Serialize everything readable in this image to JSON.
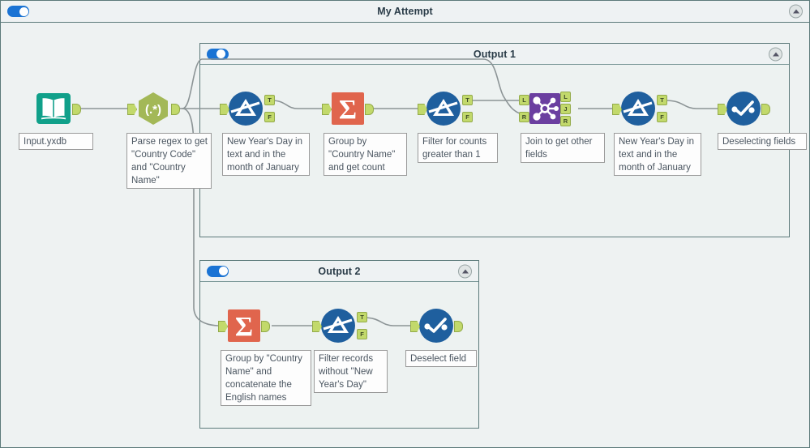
{
  "window": {
    "title": "My Attempt",
    "toggle_state": "on",
    "collapse_icon": "chevron-up-icon"
  },
  "containers": [
    {
      "id": "output1",
      "title": "Output 1",
      "toggle_state": "on",
      "collapse_icon": "chevron-up-icon"
    },
    {
      "id": "output2",
      "title": "Output 2",
      "toggle_state": "on",
      "collapse_icon": "chevron-up-icon"
    }
  ],
  "tools": [
    {
      "id": "input-data",
      "type": "input-data-tool",
      "icon": "open-book-icon",
      "color": "#10a08a",
      "annotation": "Input.yxdb",
      "outputs": [
        ""
      ]
    },
    {
      "id": "regex",
      "type": "regex-tool",
      "icon": "regex-hexagon-icon",
      "color": "#a3b857",
      "label": "(.*)",
      "annotation": "Parse regex to get \"Country Code\" and \"Country Name\"",
      "inputs": [
        ""
      ],
      "outputs": [
        ""
      ]
    },
    {
      "id": "filter-1",
      "type": "filter-tool",
      "icon": "filter-funnel-icon",
      "color": "#1f5f9e",
      "annotation": "New Year's Day in text and in the month of January",
      "inputs": [
        ""
      ],
      "outputs": [
        "T",
        "F"
      ]
    },
    {
      "id": "summarize-1",
      "type": "summarize-tool",
      "icon": "sigma-icon",
      "color": "#e0654d",
      "annotation": "Group by \"Country Name\" and get count",
      "inputs": [
        ""
      ],
      "outputs": [
        ""
      ]
    },
    {
      "id": "filter-2",
      "type": "filter-tool",
      "icon": "filter-funnel-icon",
      "color": "#1f5f9e",
      "annotation": "Filter for counts greater than 1",
      "inputs": [
        ""
      ],
      "outputs": [
        "T",
        "F"
      ]
    },
    {
      "id": "join",
      "type": "join-tool",
      "icon": "join-network-icon",
      "color": "#6b3fa0",
      "annotation": "Join to get other fields",
      "inputs": [
        "L",
        "R"
      ],
      "outputs": [
        "L",
        "J",
        "R"
      ]
    },
    {
      "id": "filter-3",
      "type": "filter-tool",
      "icon": "filter-funnel-icon",
      "color": "#1f5f9e",
      "annotation": "New Year's Day in text and in the month of January",
      "inputs": [
        ""
      ],
      "outputs": [
        "T",
        "F"
      ]
    },
    {
      "id": "select-1",
      "type": "select-tool",
      "icon": "select-check-icon",
      "color": "#1f5f9e",
      "annotation": "Deselecting fields",
      "inputs": [
        ""
      ],
      "outputs": [
        ""
      ]
    },
    {
      "id": "summarize-2",
      "type": "summarize-tool",
      "icon": "sigma-icon",
      "color": "#e0654d",
      "annotation": "Group by \"Country Name\" and concatenate the English names",
      "inputs": [
        ""
      ],
      "outputs": [
        ""
      ]
    },
    {
      "id": "filter-4",
      "type": "filter-tool",
      "icon": "filter-funnel-icon",
      "color": "#1f5f9e",
      "annotation": "Filter records without \"New Year's Day\"",
      "inputs": [
        ""
      ],
      "outputs": [
        "T",
        "F"
      ]
    },
    {
      "id": "select-2",
      "type": "select-tool",
      "icon": "select-check-icon",
      "color": "#1f5f9e",
      "annotation": "Deselect field",
      "inputs": [
        ""
      ],
      "outputs": [
        ""
      ]
    }
  ],
  "anchor_labels": {
    "true": "T",
    "false": "F",
    "left": "L",
    "right": "R",
    "join": "J"
  },
  "colors": {
    "canvas": "#eef2f2",
    "container_border": "#5c7a7a",
    "wire": "#8c9496",
    "anchor": "#c2d96b",
    "toggle_on": "#1a73d4",
    "annotation_text": "#4a5560"
  }
}
